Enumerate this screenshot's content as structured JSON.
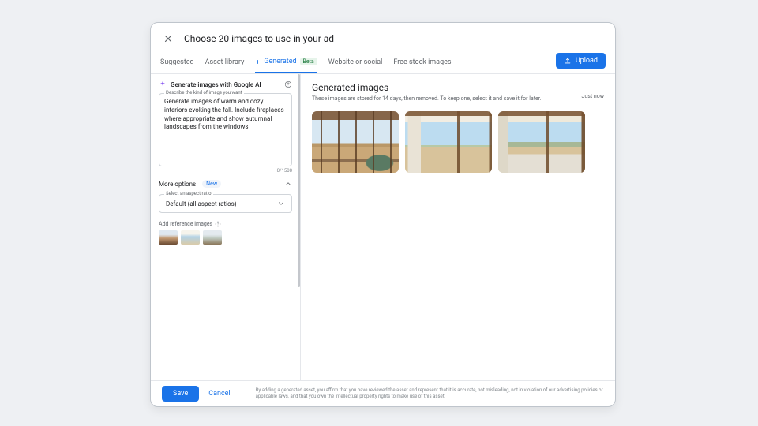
{
  "header": {
    "title": "Choose 20 images to use in your ad"
  },
  "tabs": {
    "suggested": "Suggested",
    "library": "Asset library",
    "generated": "Generated",
    "generated_badge": "Beta",
    "web": "Website or social",
    "stock": "Free stock images"
  },
  "upload_label": "Upload",
  "gen_panel": {
    "heading": "Generate images with Google AI",
    "field_label": "Describe the kind of image you want",
    "prompt_value": "Generate images of warm and cozy interiors evoking the fall. Include fireplaces where appropriate and show autumnal landscapes from the windows",
    "counter": "0/1500",
    "more_options": "More options",
    "new_pill": "New",
    "aspect_label": "Select an aspect ratio",
    "aspect_value": "Default (all aspect ratios)",
    "ref_label": "Add reference images"
  },
  "results": {
    "title": "Generated images",
    "subtitle": "These images are stored for 14 days, then removed. To keep one, select it and save it for later.",
    "timestamp": "Just now"
  },
  "footer": {
    "save": "Save",
    "cancel": "Cancel",
    "disclaimer": "By adding a generated asset, you affirm that you have reviewed the asset and represent that it is accurate, not misleading, not in violation of our advertising policies or applicable laws, and that you own the intellectual property rights to make use of this asset."
  }
}
